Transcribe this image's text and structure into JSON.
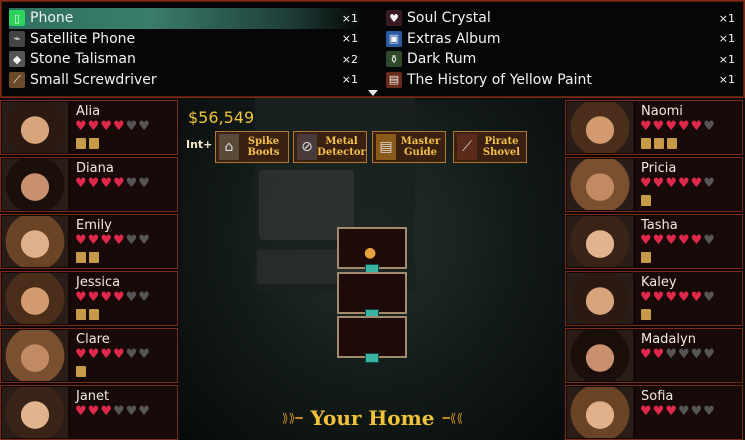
{
  "inventory": {
    "left": [
      {
        "name": "Phone",
        "qty": "×1",
        "icon": "phone-icon",
        "selected": true
      },
      {
        "name": "Satellite Phone",
        "qty": "×1",
        "icon": "satellite-phone-icon"
      },
      {
        "name": "Stone Talisman",
        "qty": "×2",
        "icon": "stone-talisman-icon"
      },
      {
        "name": "Small Screwdriver",
        "qty": "×1",
        "icon": "screwdriver-icon"
      }
    ],
    "right": [
      {
        "name": "Soul Crystal",
        "qty": "×1",
        "icon": "soul-crystal-icon"
      },
      {
        "name": "Extras Album",
        "qty": "×1",
        "icon": "album-icon"
      },
      {
        "name": "Dark Rum",
        "qty": "×1",
        "icon": "rum-bottle-icon"
      },
      {
        "name": "The History of Yellow Paint",
        "qty": "×1",
        "icon": "book-icon"
      }
    ]
  },
  "money": "$56,549",
  "int_label": "Int+",
  "tools": [
    {
      "label": "Spike\nBoots",
      "icon": "boots-icon"
    },
    {
      "label": "Metal\nDetector",
      "icon": "metal-detector-icon"
    },
    {
      "label": "Master\nGuide",
      "icon": "guide-book-icon"
    },
    {
      "label": "Pirate\nShovel",
      "icon": "shovel-icon"
    }
  ],
  "characters_left": [
    {
      "name": "Alia",
      "hearts": 4,
      "items": 2
    },
    {
      "name": "Diana",
      "hearts": 4,
      "items": 0
    },
    {
      "name": "Emily",
      "hearts": 4,
      "items": 2
    },
    {
      "name": "Jessica",
      "hearts": 4,
      "items": 2
    },
    {
      "name": "Clare",
      "hearts": 4,
      "items": 1
    },
    {
      "name": "Janet",
      "hearts": 3,
      "items": 0
    }
  ],
  "characters_right": [
    {
      "name": "Naomi",
      "hearts": 5,
      "items": 3
    },
    {
      "name": "Pricia",
      "hearts": 5,
      "items": 1
    },
    {
      "name": "Tasha",
      "hearts": 5,
      "items": 1
    },
    {
      "name": "Kaley",
      "hearts": 5,
      "items": 1
    },
    {
      "name": "Madalyn",
      "hearts": 2,
      "items": 0
    },
    {
      "name": "Sofia",
      "hearts": 3,
      "items": 0
    }
  ],
  "max_hearts": 6,
  "location": "Your Home",
  "colors": {
    "border": "#7d2a16",
    "heart": "#e0284b",
    "gold": "#f0c23a",
    "teal": "#3a7d6a"
  }
}
